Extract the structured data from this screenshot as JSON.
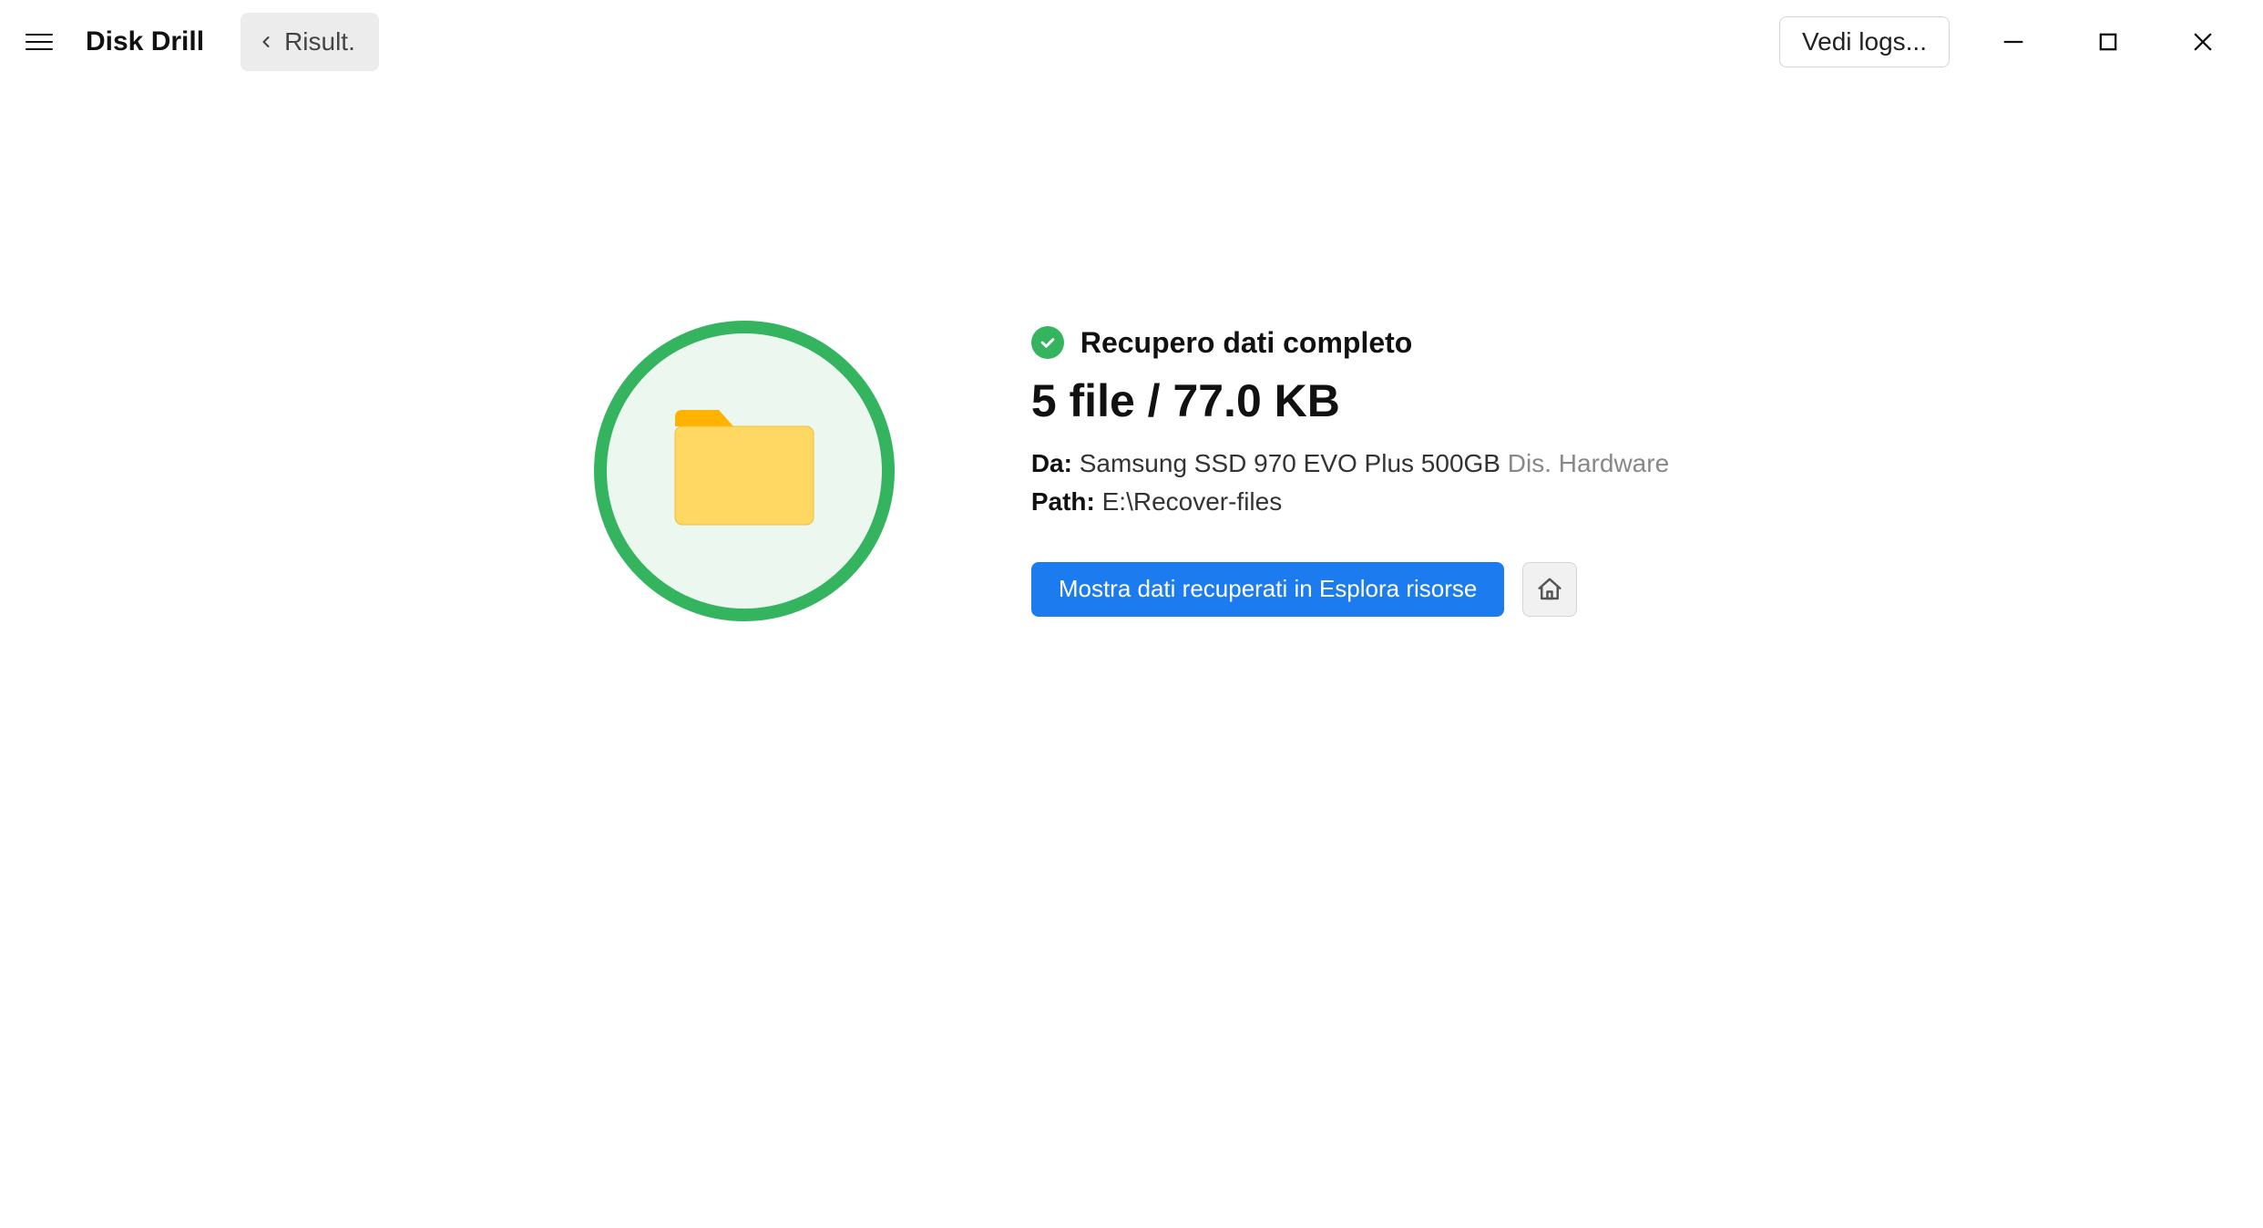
{
  "app": {
    "title": "Disk Drill"
  },
  "topbar": {
    "back_label": "Risult.",
    "logs_button": "Vedi logs..."
  },
  "result": {
    "status": "Recupero dati completo",
    "summary": "5 file / 77.0 KB",
    "from_label": "Da:",
    "from_value": "Samsung SSD 970 EVO Plus 500GB",
    "from_muted": "Dis. Hardware",
    "path_label": "Path:",
    "path_value": "E:\\Recover-files",
    "show_button": "Mostra dati recuperati in Esplora risorse"
  },
  "colors": {
    "accent_green": "#34b45f",
    "accent_blue": "#1d7bf0",
    "folder_yellow": "#ffd763",
    "folder_tab": "#ffb300"
  }
}
